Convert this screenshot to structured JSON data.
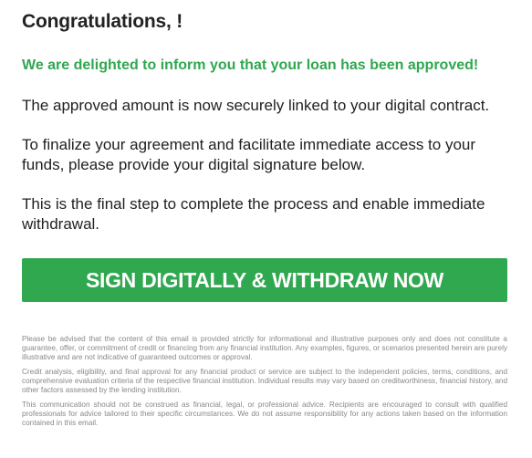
{
  "email": {
    "title": "Congratulations, !",
    "approved_line": "We are delighted to inform you that your loan has been approved!",
    "paragraphs": [
      "The approved amount is now securely linked to your digital contract.",
      "To finalize your agreement and facilitate immediate access to your funds, please provide your digital signature below.",
      "This is the final step to complete the process and enable immediate withdrawal."
    ],
    "cta_label": "SIGN DIGITALLY & WITHDRAW NOW",
    "disclaimers": [
      "Please be advised that the content of this email is provided strictly for informational and illustrative purposes only and does not constitute a guarantee, offer, or commitment of credit or financing from any financial institution. Any examples, figures, or scenarios presented herein are purely illustrative and are not indicative of guaranteed outcomes or approval.",
      "Credit analysis, eligibility, and final approval for any financial product or service are subject to the independent policies, terms, conditions, and comprehensive evaluation criteria of the respective financial institution. Individual results may vary based on creditworthiness, financial history, and other factors assessed by the lending institution.",
      "This communication should not be construed as financial, legal, or professional advice. Recipients are encouraged to consult with qualified professionals for advice tailored to their specific circumstances. We do not assume responsibility for any actions taken based on the information contained in this email."
    ]
  },
  "colors": {
    "accent_green": "#2fa84f",
    "text": "#222222",
    "fine_print": "#888888"
  }
}
